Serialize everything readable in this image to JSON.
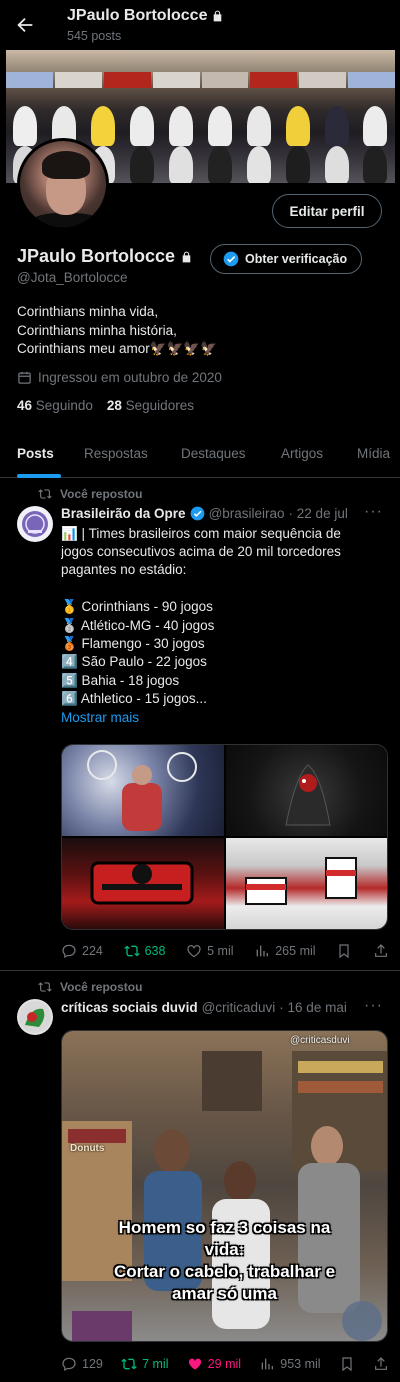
{
  "header": {
    "name": "JPaulo Bortolocce",
    "post_count": "545 posts"
  },
  "profile": {
    "name": "JPaulo Bortolocce",
    "handle": "@Jota_Bortolocce",
    "edit_label": "Editar perfil",
    "verify_label": "Obter verificação",
    "bio": [
      "Corinthians minha vida,",
      "Corinthians minha história,",
      "Corinthians meu amor🦅🦅🦅🦅"
    ],
    "joined": "Ingressou em outubro de 2020",
    "following_count": "46",
    "following_label": "Seguindo",
    "followers_count": "28",
    "followers_label": "Seguidores"
  },
  "tabs": [
    "Posts",
    "Respostas",
    "Destaques",
    "Artigos",
    "Mídia"
  ],
  "posts": [
    {
      "repost_label": "Você repostou",
      "author": "Brasileirão da Opre",
      "handle": "@brasileirao",
      "date": "· 22 de jul",
      "lines": [
        "📊 | Times brasileiros com maior sequência de",
        "jogos consecutivos acima de 20 mil torcedores",
        "pagantes no estádio:",
        "",
        "🥇 Corinthians - 90 jogos",
        "🥈 Atlético-MG - 40 jogos",
        "🥉 Flamengo - 30 jogos",
        "4️⃣ São Paulo - 22 jogos",
        "5️⃣ Bahia - 18 jogos",
        "6️⃣ Athletico - 15 jogos..."
      ],
      "show_more": "Mostrar mais",
      "stats": {
        "replies": "224",
        "reposts": "638",
        "likes": "5 mil",
        "views": "265 mil"
      }
    },
    {
      "repost_label": "Você repostou",
      "author": "críticas sociais duvid",
      "handle": "@criticaduvi",
      "date": "· 16 de mai",
      "watermark": "@criticasduvi",
      "caption": [
        "Homem so faz 3 coisas na",
        "vida:",
        "Cortar o cabelo, trabalhar e",
        "amar só uma"
      ],
      "sign": "Donuts",
      "stats": {
        "replies": "129",
        "reposts": "7 mil",
        "likes": "29 mil",
        "views": "953 mil"
      }
    }
  ],
  "colors": {
    "accent": "#1d9bf0",
    "repost": "#00ba7c",
    "like": "#f91880",
    "muted": "#71767b"
  }
}
